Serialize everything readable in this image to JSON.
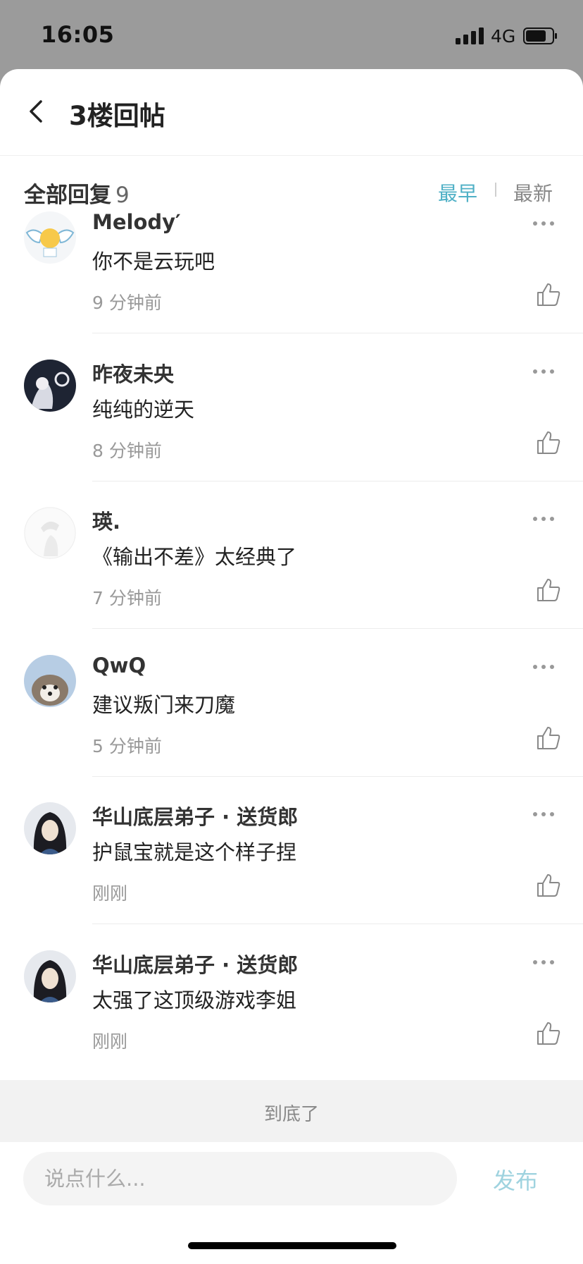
{
  "status_bar": {
    "time": "16:05",
    "network": "4G",
    "icons": [
      "signal-icon",
      "battery-icon"
    ]
  },
  "nav": {
    "title": "3楼回帖",
    "back_icon": "chevron-left-icon"
  },
  "section": {
    "label": "全部回复",
    "count": "9",
    "sort_options": [
      "最早",
      "最新"
    ],
    "active_sort": "最早"
  },
  "replies": [
    {
      "name": "Melody′",
      "content": "你不是云玩吧",
      "time": "9 分钟前"
    },
    {
      "name": "昨夜未央",
      "content": "纯纯的逆天",
      "time": "8 分钟前"
    },
    {
      "name": "瑛.",
      "content": "《输出不差》太经典了",
      "time": "7 分钟前"
    },
    {
      "name": "QwQ",
      "content": "建议叛门来刀魔",
      "time": "5 分钟前"
    },
    {
      "name": "华山底层弟子 · 送货郎",
      "content": "护鼠宝就是这个样子捏",
      "time": "刚刚"
    },
    {
      "name": "华山底层弟子 · 送货郎",
      "content": "太强了这顶级游戏李姐",
      "time": "刚刚"
    }
  ],
  "footer": {
    "end_text": "到底了",
    "input_placeholder": "说点什么...",
    "publish_label": "发布"
  },
  "colors": {
    "accent": "#4fb0c6",
    "publish_disabled": "#9fd3df",
    "background_dim": "#9b9b9b"
  }
}
